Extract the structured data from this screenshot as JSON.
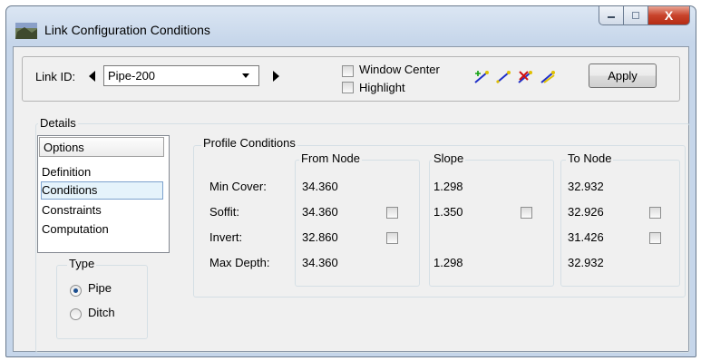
{
  "window": {
    "title": "Link Configuration Conditions",
    "close_label": "X"
  },
  "toolbar": {
    "link_id_label": "Link ID:",
    "link_value": "Pipe-200",
    "window_center_label": "Window Center",
    "highlight_label": "Highlight",
    "apply_label": "Apply",
    "tools": [
      "add-vertex-icon",
      "edit-link-icon",
      "delete-vertex-icon",
      "move-vertex-icon"
    ]
  },
  "details": {
    "label": "Details",
    "options_header": "Options",
    "options": [
      "Definition",
      "Conditions",
      "Constraints",
      "Computation"
    ],
    "selected_option": "Conditions"
  },
  "type": {
    "label": "Type",
    "options": [
      "Pipe",
      "Ditch"
    ],
    "selected": "Pipe"
  },
  "profile": {
    "label": "Profile Conditions",
    "columns": {
      "from": "From Node",
      "slope": "Slope",
      "to": "To Node"
    },
    "rows": {
      "min_cover": {
        "label": "Min Cover:",
        "from": "34.360",
        "slope": "1.298",
        "to": "32.932"
      },
      "soffit": {
        "label": "Soffit:",
        "from": "34.360",
        "slope": "1.350",
        "to": "32.926"
      },
      "invert": {
        "label": "Invert:",
        "from": "32.860",
        "to": "31.426"
      },
      "max_depth": {
        "label": "Max Depth:",
        "from": "34.360",
        "slope": "1.298",
        "to": "32.932"
      }
    }
  }
}
